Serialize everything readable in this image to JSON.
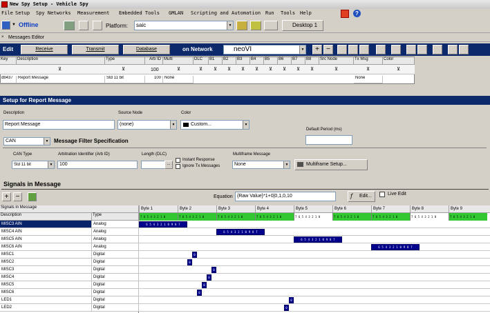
{
  "title": "New Spy Setup - Vehicle Spy",
  "menu": [
    "File",
    "Setup",
    "Spy Networks",
    "Measurement",
    "Embedded Tools",
    "GMLAN",
    "Scripting and Automation",
    "Run",
    "Tools",
    "Help"
  ],
  "toolbar": {
    "status": "Offline",
    "platform_label": "Platform:",
    "platform_value": "saic",
    "desktop_label": "Desktop 1"
  },
  "messages_editor": {
    "title": "Messages Editor",
    "edit_label": "Edit",
    "tabs": [
      "Receive",
      "Transmit",
      "Database"
    ],
    "on_network_label": "on Network",
    "network_value": "neoVI",
    "columns": [
      "Key",
      "Description",
      "Type",
      "Arb ID",
      "Multi",
      "DLC",
      "B1",
      "B2",
      "B3",
      "B4",
      "B5",
      "B6",
      "B7",
      "B8",
      "Src Node",
      "Tx Msg",
      "Color"
    ],
    "filter_row": {
      "arb_id": "100"
    },
    "row": {
      "key": "db437",
      "description": "Report Message",
      "type": "Std 11 bit",
      "arb_id": "100",
      "multi": "None",
      "tx_msg": "None"
    }
  },
  "setup": {
    "title": "Setup for Report Message",
    "description_label": "Description",
    "description_value": "Report Message",
    "source_node_label": "Source Node",
    "source_node_value": "(none)",
    "color_label": "Color",
    "color_value": "Custom...",
    "default_period_label": "Default Period (ms)",
    "protocol_value": "CAN",
    "filter_spec_label": "Message Filter Specification",
    "can_type_label": "CAN Type",
    "can_type_value": "Std 11 bit",
    "arb_id_label": "Arbitration Identifier (Arb ID)",
    "arb_id_value": "100",
    "length_label": "Length (DLC)",
    "length_value": "",
    "instant_response": "Instant Response",
    "ignore_tx": "Ignore Tx Messages",
    "multiframe_label": "Multiframe Message",
    "multiframe_value": "None",
    "multiframe_btn": "Multiframe Setup..."
  },
  "signals": {
    "title": "Signals in Message",
    "equation_label": "Equation",
    "equation_value": "{Raw Value}*1+0|0,1,0,10",
    "edit_btn": "Edit...",
    "live_edit": "Live Edit",
    "col_signals": "Signals in Message",
    "col_description": "Description",
    "col_type": "Type",
    "bytes": [
      "Byte 1",
      "Byte 2",
      "Byte 3",
      "Byte 4",
      "Byte 5",
      "Byte 6",
      "Byte 7",
      "Byte 8",
      "Byte 9"
    ],
    "rows": [
      {
        "name": "MISC3 AIN",
        "type": "Analog"
      },
      {
        "name": "MISC4 AIN",
        "type": "Analog"
      },
      {
        "name": "MISC5 AIN",
        "type": "Analog"
      },
      {
        "name": "MISC6 AIN",
        "type": "Analog"
      },
      {
        "name": "MISC1",
        "type": "Digital"
      },
      {
        "name": "MISC2",
        "type": "Digital"
      },
      {
        "name": "MISC3",
        "type": "Digital"
      },
      {
        "name": "MISC4",
        "type": "Digital"
      },
      {
        "name": "MISC5",
        "type": "Digital"
      },
      {
        "name": "MISC6",
        "type": "Digital"
      },
      {
        "name": "LED1",
        "type": "Digital"
      },
      {
        "name": "LED2",
        "type": "Digital"
      }
    ],
    "analog_bits": "6 5 4 3 2 1 0 9 8 7",
    "digital_bit": "0",
    "bit_numbers": "7 6 5 4 3 2 1 0"
  }
}
